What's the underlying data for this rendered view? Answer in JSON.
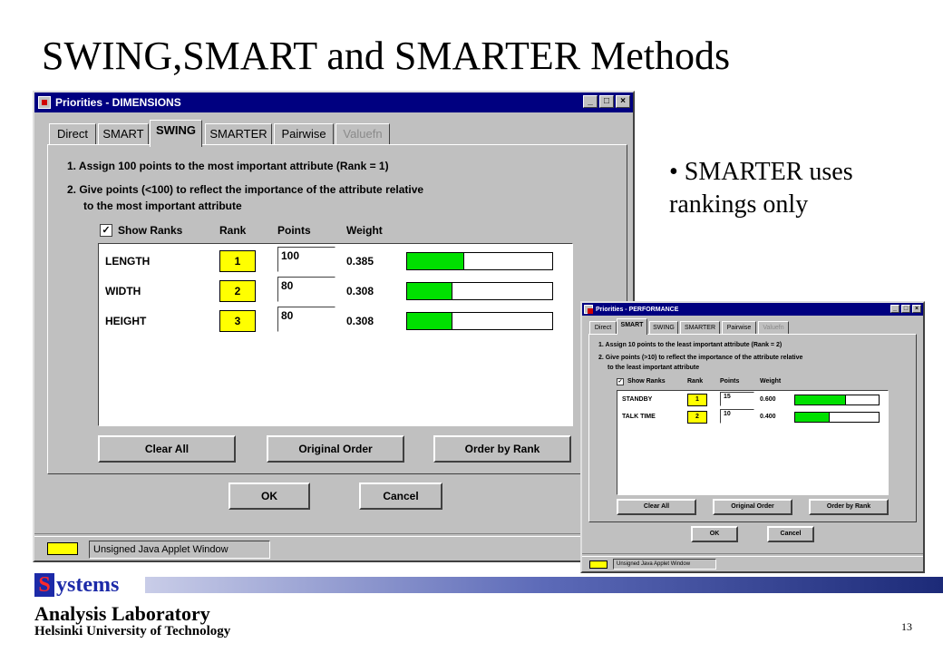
{
  "slide": {
    "title": "SWING,SMART and SMARTER Methods",
    "bullet": "• SMARTER uses rankings only",
    "page_number": "13"
  },
  "footer": {
    "logo_letter": "S",
    "logo_rest": "ystems",
    "lab": "Analysis Laboratory",
    "university": "Helsinki University of Technology"
  },
  "window_main": {
    "title": "Priorities - DIMENSIONS",
    "tabs": [
      {
        "label": "Direct",
        "state": "normal"
      },
      {
        "label": "SMART",
        "state": "normal"
      },
      {
        "label": "SWING",
        "state": "active"
      },
      {
        "label": "SMARTER",
        "state": "normal"
      },
      {
        "label": "Pairwise",
        "state": "normal"
      },
      {
        "label": "Valuefn",
        "state": "disabled"
      }
    ],
    "instruction_1": "1. Assign 100 points to the most important attribute (Rank = 1)",
    "instruction_2a": "2. Give points (<100) to reflect the importance of the attribute relative",
    "instruction_2b": "to the most important attribute",
    "show_ranks_label": "Show Ranks",
    "show_ranks_checked": "☑",
    "headers": {
      "rank": "Rank",
      "points": "Points",
      "weight": "Weight"
    },
    "rows": [
      {
        "name": "LENGTH",
        "rank": "1",
        "points": "100",
        "weight": "0.385",
        "bar_fraction": 0.385
      },
      {
        "name": "WIDTH",
        "rank": "2",
        "points": "80",
        "weight": "0.308",
        "bar_fraction": 0.308
      },
      {
        "name": "HEIGHT",
        "rank": "3",
        "points": "80",
        "weight": "0.308",
        "bar_fraction": 0.308
      }
    ],
    "buttons": {
      "clear_all": "Clear All",
      "original_order": "Original Order",
      "order_by_rank": "Order by Rank",
      "ok": "OK",
      "cancel": "Cancel"
    },
    "status": "Unsigned Java Applet Window"
  },
  "window_small": {
    "title": "Priorities - PERFORMANCE",
    "tabs": [
      {
        "label": "Direct",
        "state": "normal"
      },
      {
        "label": "SMART",
        "state": "active"
      },
      {
        "label": "SWING",
        "state": "normal"
      },
      {
        "label": "SMARTER",
        "state": "normal"
      },
      {
        "label": "Pairwise",
        "state": "normal"
      },
      {
        "label": "Valuefn",
        "state": "disabled"
      }
    ],
    "instruction_1": "1. Assign 10 points to the least important attribute (Rank = 2)",
    "instruction_2a": "2. Give points (>10) to reflect the importance of the attribute relative",
    "instruction_2b": "to the least important attribute",
    "show_ranks_label": "Show Ranks",
    "show_ranks_checked": "☑",
    "headers": {
      "rank": "Rank",
      "points": "Points",
      "weight": "Weight"
    },
    "rows": [
      {
        "name": "STANDBY",
        "rank": "1",
        "points": "15",
        "weight": "0.600",
        "bar_fraction": 0.6
      },
      {
        "name": "TALK TIME",
        "rank": "2",
        "points": "10",
        "weight": "0.400",
        "bar_fraction": 0.4
      }
    ],
    "buttons": {
      "clear_all": "Clear All",
      "original_order": "Original Order",
      "order_by_rank": "Order by Rank",
      "ok": "OK",
      "cancel": "Cancel"
    },
    "status": "Unsigned Java Applet Window"
  },
  "colors": {
    "titlebar": "#000080",
    "window_face": "#c0c0c0",
    "rank_fill": "#ffff00",
    "bar_fill": "#00e000",
    "logo_blue": "#1c2aa8",
    "logo_red": "#ff2a2a"
  }
}
